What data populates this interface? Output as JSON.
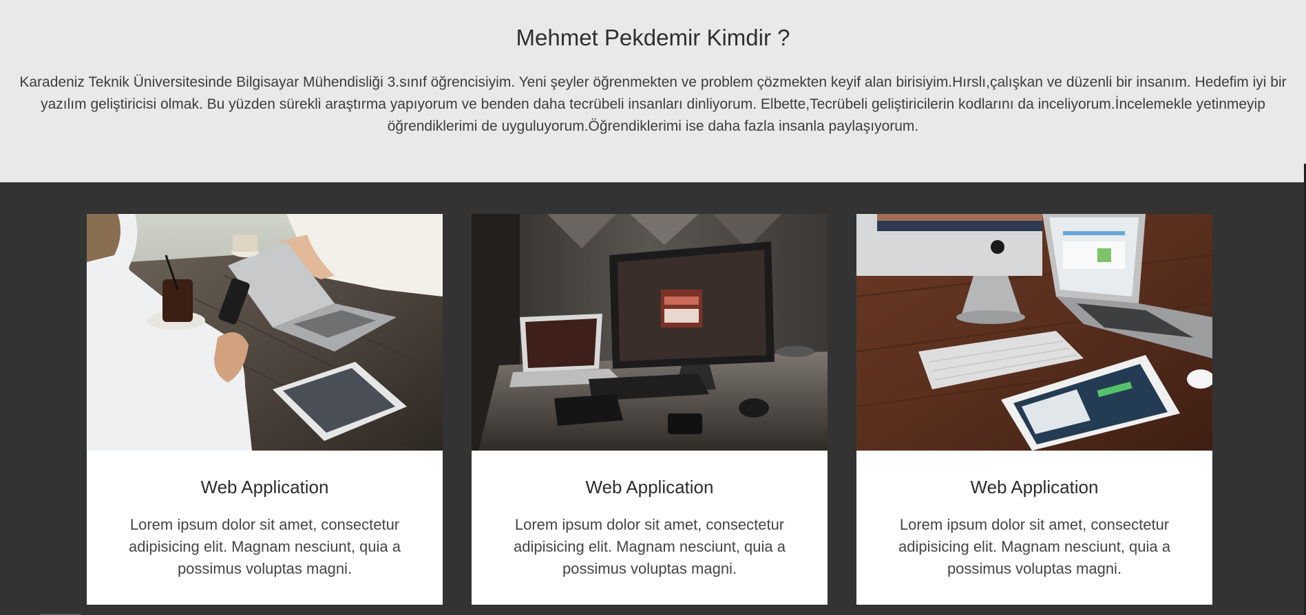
{
  "about": {
    "title": "Mehmet Pekdemir Kimdir ?",
    "text": "Karadeniz Teknik Üniversitesinde Bilgisayar Mühendisliği 3.sınıf öğrencisiyim. Yeni şeyler öğrenmekten ve problem çözmekten keyif alan birisiyim.Hırslı,çalışkan ve düzenli bir insanım. Hedefim iyi bir yazılım geliştiricisi olmak. Bu yüzden sürekli araştırma yapıyorum ve benden daha tecrübeli insanları dinliyorum. Elbette,Tecrübeli geliştiricilerin kodlarını da inceliyorum.İncelemekle yetinmeyip öğrendiklerimi de uyguluyorum.Öğrendiklerimi ise daha fazla insanla paylaşıyorum."
  },
  "cards": [
    {
      "title": "Web Application",
      "text": "Lorem ipsum dolor sit amet, consectetur adipisicing elit. Magnam nesciunt, quia a possimus voluptas magni.",
      "image": "people-with-laptop-phone-tablet-photo"
    },
    {
      "title": "Web Application",
      "text": "Lorem ipsum dolor sit amet, consectetur adipisicing elit. Magnam nesciunt, quia a possimus voluptas magni.",
      "image": "desk-monitor-open-sign-photo"
    },
    {
      "title": "Web Application",
      "text": "Lorem ipsum dolor sit amet, consectetur adipisicing elit. Magnam nesciunt, quia a possimus voluptas magni.",
      "image": "imac-macbook-ipad-desk-photo"
    }
  ],
  "colors": {
    "about_bg": "#e9e9e9",
    "services_bg": "#333333",
    "card_bg": "#ffffff"
  }
}
